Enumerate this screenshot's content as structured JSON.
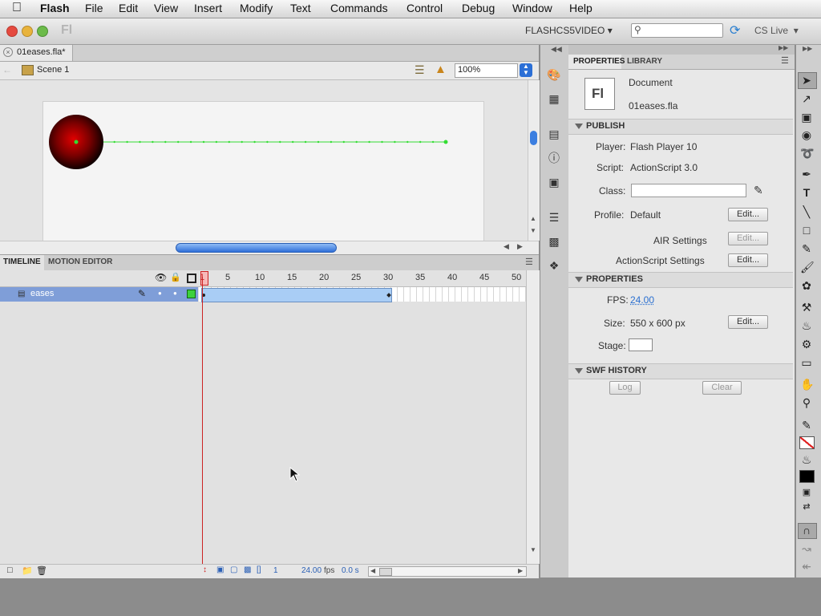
{
  "menubar": {
    "apple_icon": "apple-icon",
    "items": [
      "Flash",
      "File",
      "Edit",
      "View",
      "Insert",
      "Modify",
      "Text",
      "Commands",
      "Control",
      "Debug",
      "Window",
      "Help"
    ]
  },
  "appbar": {
    "logo": "Fl",
    "workspace": "FLASHCS5VIDEO",
    "search_placeholder": "",
    "cs_live": "CS Live"
  },
  "document": {
    "tab_title": "01eases.fla*",
    "scene": "Scene 1",
    "zoom": "100%"
  },
  "timeline": {
    "tabs": [
      "TIMELINE",
      "MOTION EDITOR"
    ],
    "frame_numbers": [
      "1",
      "5",
      "10",
      "15",
      "20",
      "25",
      "30",
      "35",
      "40",
      "45",
      "50"
    ],
    "layer_name": "eases",
    "current_frame": "1",
    "fps": "24.00",
    "fps_unit": "fps",
    "time": "0.0 s"
  },
  "properties": {
    "tabs": [
      "PROPERTIES",
      "LIBRARY"
    ],
    "doc_icon": "Fl",
    "doc_type": "Document",
    "doc_name": "01eases.fla",
    "publish": {
      "header": "PUBLISH",
      "player_label": "Player:",
      "player_value": "Flash Player 10",
      "script_label": "Script:",
      "script_value": "ActionScript 3.0",
      "class_label": "Class:",
      "class_value": "",
      "profile_label": "Profile:",
      "profile_value": "Default",
      "edit": "Edit...",
      "air_settings": "AIR Settings",
      "as_settings": "ActionScript Settings"
    },
    "props": {
      "header": "PROPERTIES",
      "fps_label": "FPS:",
      "fps_value": "24.00",
      "size_label": "Size:",
      "size_value": "550 x 600 px",
      "stage_label": "Stage:",
      "edit": "Edit..."
    },
    "swf": {
      "header": "SWF HISTORY",
      "log": "Log",
      "clear": "Clear"
    }
  },
  "colors": {
    "ball_center": "#e00000",
    "motion_path": "#33dd33",
    "playhead": "#cc2222",
    "layer_selected": "#7f9ed8",
    "tween_span": "#a9cdf5"
  }
}
